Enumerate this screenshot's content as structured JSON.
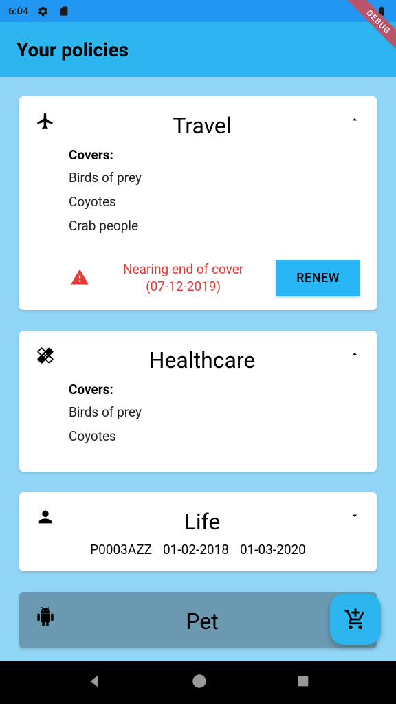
{
  "status": {
    "time": "6:04"
  },
  "app": {
    "title": "Your policies"
  },
  "debug_label": "DEBUG",
  "covers_label": "Covers:",
  "policies": [
    {
      "title": "Travel",
      "expanded": true,
      "covers": [
        "Birds of prey",
        "Coyotes",
        "Crab people"
      ],
      "warning": {
        "line1": "Nearing end of cover",
        "line2": "(07-12-2019)"
      },
      "renew_label": "RENEW"
    },
    {
      "title": "Healthcare",
      "expanded": true,
      "covers": [
        "Birds of prey",
        "Coyotes"
      ]
    },
    {
      "title": "Life",
      "expanded": false,
      "policy_number": "P0003AZZ",
      "start_date": "01-02-2018",
      "end_date": "01-03-2020"
    },
    {
      "title": "Pet",
      "expanded": false,
      "selected": true
    }
  ]
}
